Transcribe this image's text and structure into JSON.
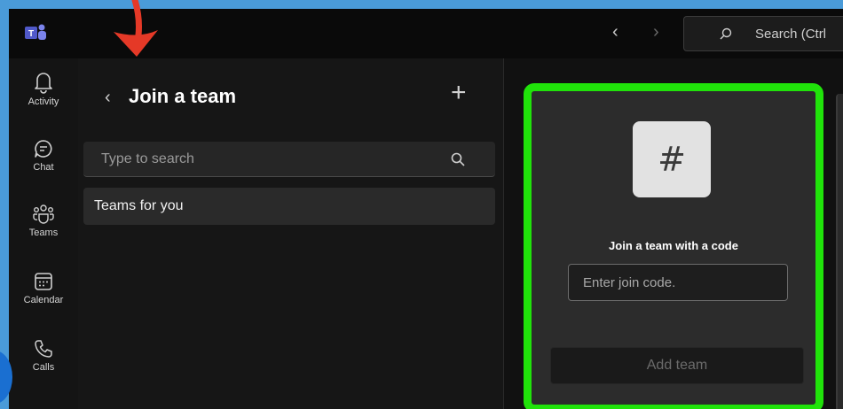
{
  "titlebar": {
    "logo_icon": "teams-logo-icon",
    "search_placeholder": "Search (Ctrl"
  },
  "rail": {
    "items": [
      {
        "label": "Activity",
        "icon": "bell-icon"
      },
      {
        "label": "Chat",
        "icon": "chat-icon"
      },
      {
        "label": "Teams",
        "icon": "teams-icon"
      },
      {
        "label": "Calendar",
        "icon": "calendar-icon"
      },
      {
        "label": "Calls",
        "icon": "phone-icon"
      }
    ]
  },
  "pane": {
    "back_glyph": "‹",
    "title": "Join a team",
    "plus_glyph": "+",
    "search_placeholder": "Type to search",
    "list": [
      {
        "label": "Teams for you"
      }
    ]
  },
  "main": {
    "hash_glyph": "#",
    "card_title": "Join a team with a code",
    "code_placeholder": "Enter join code.",
    "add_button": "Add team"
  },
  "colors": {
    "highlight": "#20e30a",
    "arrow": "#e53927",
    "frame": "#4a9bd9"
  }
}
